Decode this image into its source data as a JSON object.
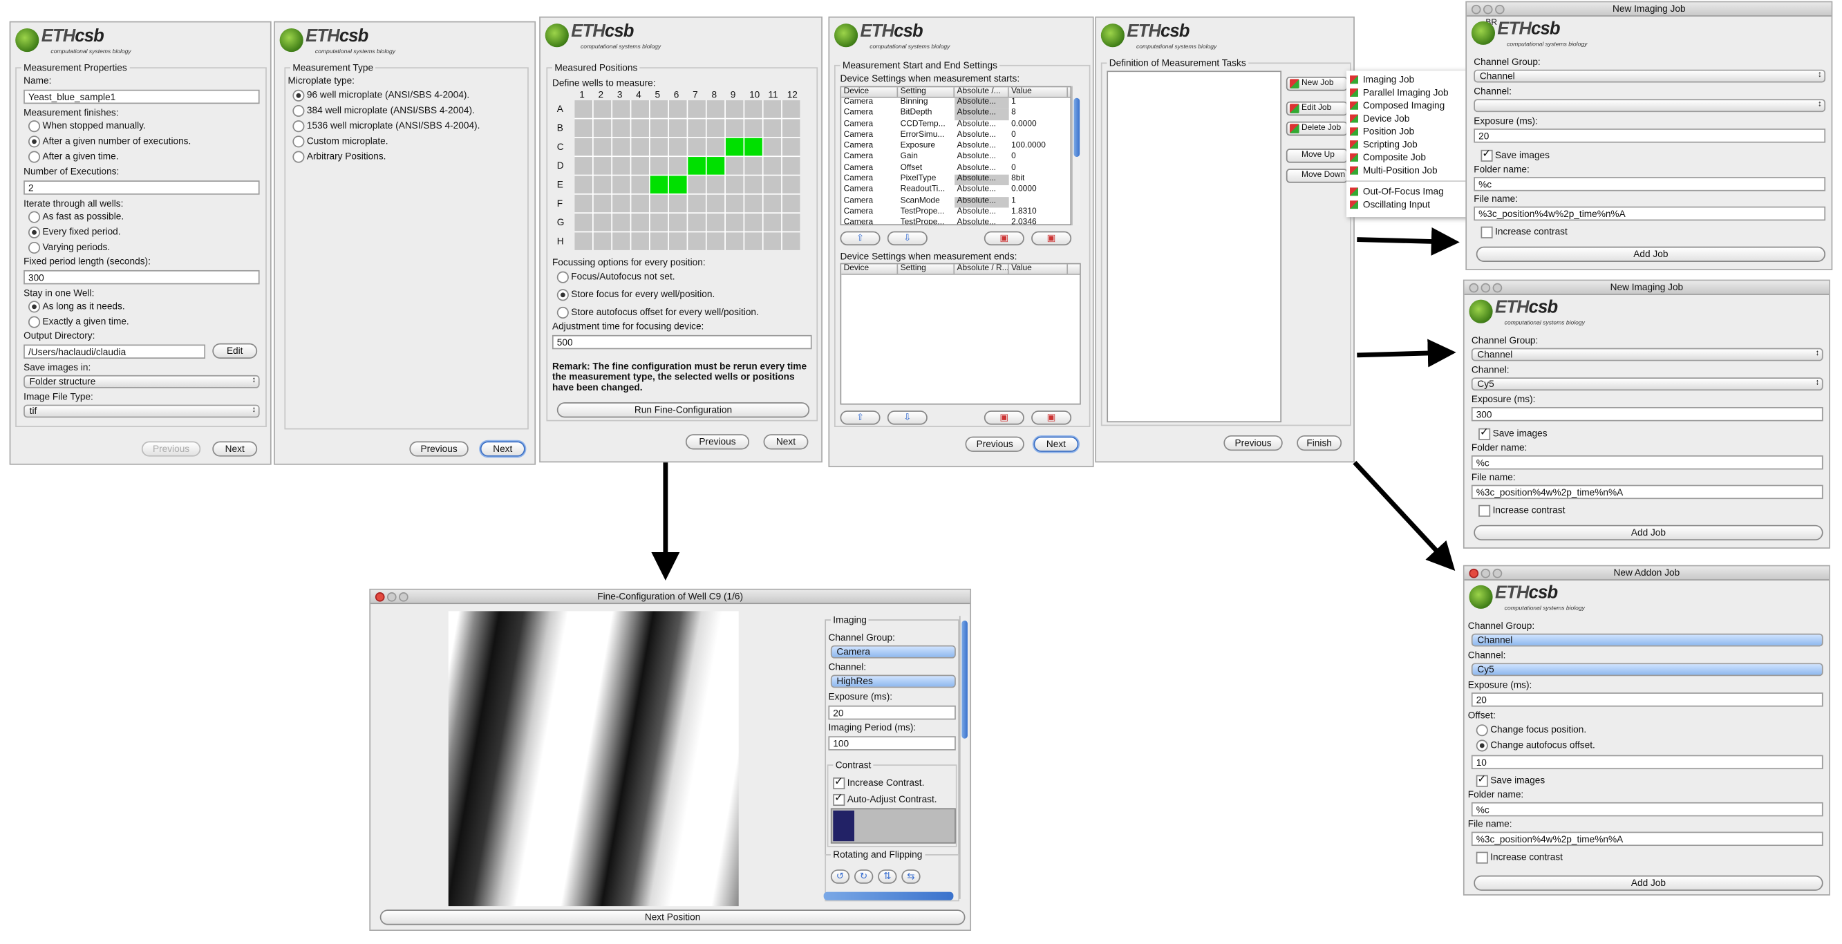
{
  "logo": {
    "name": "ETHcsb",
    "subtitle": "computational systems biology"
  },
  "p1": {
    "group": "Measurement Properties",
    "name_label": "Name:",
    "name_value": "Yeast_blue_sample1",
    "finishes_label": "Measurement finishes:",
    "finishes": [
      "When stopped manually.",
      "After a given number of executions.",
      "After a given time."
    ],
    "num_exec_label": "Number of Executions:",
    "num_exec_value": "2",
    "iterate_label": "Iterate through all wells:",
    "iterate": [
      "As fast as possible.",
      "Every fixed period.",
      "Varying periods."
    ],
    "period_label": "Fixed period length (seconds):",
    "period_value": "300",
    "stay_label": "Stay in one Well:",
    "stay": [
      "As long as it needs.",
      "Exactly a given time."
    ],
    "outdir_label": "Output Directory:",
    "outdir_value": "/Users/haclaudi/claudia",
    "edit": "Edit",
    "save_label": "Save images in:",
    "save_value": "Folder structure",
    "filetype_label": "Image File Type:",
    "filetype_value": "tif",
    "previous": "Previous",
    "next": "Next"
  },
  "p2": {
    "group": "Measurement Type",
    "plate_label": "Microplate type:",
    "options": [
      "96 well microplate (ANSI/SBS 4-2004).",
      "384 well microplate (ANSI/SBS 4-2004).",
      "1536 well microplate (ANSI/SBS 4-2004).",
      "Custom microplate.",
      "Arbitrary Positions."
    ],
    "previous": "Previous",
    "next": "Next"
  },
  "p3": {
    "group": "Measured Positions",
    "define_label": "Define wells to measure:",
    "cols": [
      "1",
      "2",
      "3",
      "4",
      "5",
      "6",
      "7",
      "8",
      "9",
      "10",
      "11",
      "12"
    ],
    "rows": [
      "A",
      "B",
      "C",
      "D",
      "E",
      "F",
      "G",
      "H"
    ],
    "focus_label": "Focussing options for every position:",
    "focus": [
      "Focus/Autofocus not set.",
      "Store focus for every well/position.",
      "Store autofocus offset for every well/position."
    ],
    "adj_label": "Adjustment time for focusing device:",
    "adj_value": "500",
    "remark": "Remark: The fine configuration must be rerun every time the measurement type, the selected wells or positions have been changed.",
    "run": "Run Fine-Configuration",
    "previous": "Previous",
    "next": "Next"
  },
  "p4": {
    "group": "Measurement Start and End Settings",
    "start_label": "Device Settings when measurement starts:",
    "headers": [
      "Device",
      "Setting",
      "Absolute /...",
      "Value"
    ],
    "rows": [
      [
        "Camera",
        "Binning",
        "Absolute...",
        "1"
      ],
      [
        "Camera",
        "BitDepth",
        "Absolute...",
        "8"
      ],
      [
        "Camera",
        "CCDTemp...",
        "Absolute...",
        "0.0000"
      ],
      [
        "Camera",
        "ErrorSimu...",
        "Absolute...",
        "0"
      ],
      [
        "Camera",
        "Exposure",
        "Absolute...",
        "100.0000"
      ],
      [
        "Camera",
        "Gain",
        "Absolute...",
        "0"
      ],
      [
        "Camera",
        "Offset",
        "Absolute...",
        "0"
      ],
      [
        "Camera",
        "PixelType",
        "Absolute...",
        "8bit"
      ],
      [
        "Camera",
        "ReadoutTi...",
        "Absolute...",
        "0.0000"
      ],
      [
        "Camera",
        "ScanMode",
        "Absolute...",
        "1"
      ],
      [
        "Camera",
        "TestPrope...",
        "Absolute...",
        "1.8310"
      ],
      [
        "Camera",
        "TestPrope...",
        "Absolute...",
        "2.0346"
      ]
    ],
    "end_label": "Device Settings when measurement ends:",
    "end_headers": [
      "Device",
      "Setting",
      "Absolute / R...",
      "Value"
    ],
    "previous": "Previous",
    "next": "Next"
  },
  "p5": {
    "group": "Definition of Measurement Tasks",
    "buttons": [
      "New Job",
      "Edit Job",
      "Delete Job",
      "Move Up",
      "Move Down"
    ],
    "menu": [
      "Imaging Job",
      "Parallel Imaging Job",
      "Composed Imaging",
      "Device Job",
      "Position Job",
      "Scripting Job",
      "Composite Job",
      "Multi-Position Job",
      "Out-Of-Focus Imag",
      "Oscillating Input"
    ],
    "previous": "Previous",
    "finish": "Finish"
  },
  "j1": {
    "title": "New Imaging Job",
    "br": "BR",
    "cg_label": "Channel Group:",
    "cg": "Channel",
    "ch_label": "Channel:",
    "ch": "",
    "exp_label": "Exposure (ms):",
    "exp": "20",
    "save": "Save images",
    "folder_label": "Folder name:",
    "folder": "%c",
    "file_label": "File name:",
    "file": "%3c_position%4w%2p_time%n%A",
    "contrast": "Increase contrast",
    "add": "Add Job"
  },
  "j2": {
    "title": "New Imaging Job",
    "cg_label": "Channel Group:",
    "cg": "Channel",
    "ch_label": "Channel:",
    "ch": "Cy5",
    "exp_label": "Exposure (ms):",
    "exp": "300",
    "save": "Save images",
    "folder_label": "Folder name:",
    "folder": "%c",
    "file_label": "File name:",
    "file": "%3c_position%4w%2p_time%n%A",
    "contrast": "Increase contrast",
    "add": "Add Job"
  },
  "j3": {
    "title": "New Addon Job",
    "cg_label": "Channel Group:",
    "cg": "Channel",
    "ch_label": "Channel:",
    "ch": "Cy5",
    "exp_label": "Exposure (ms):",
    "exp": "20",
    "offset_label": "Offset:",
    "offsets": [
      "Change focus position.",
      "Change autofocus offset."
    ],
    "offset_value": "10",
    "save": "Save images",
    "folder_label": "Folder name:",
    "folder": "%c",
    "file_label": "File name:",
    "file": "%3c_position%4w%2p_time%n%A",
    "contrast": "Increase contrast",
    "add": "Add Job"
  },
  "fc": {
    "title": "Fine-Configuration of Well C9 (1/6)",
    "imaging": "Imaging",
    "cg_label": "Channel Group:",
    "cg": "Camera",
    "ch_label": "Channel:",
    "ch": "HighRes",
    "exp_label": "Exposure (ms):",
    "exp": "20",
    "period_label": "Imaging Period (ms):",
    "period": "100",
    "contrast": "Contrast",
    "inc": "Increase Contrast.",
    "auto": "Auto-Adjust Contrast.",
    "rot": "Rotating and Flipping",
    "next_pos": "Next Position"
  }
}
